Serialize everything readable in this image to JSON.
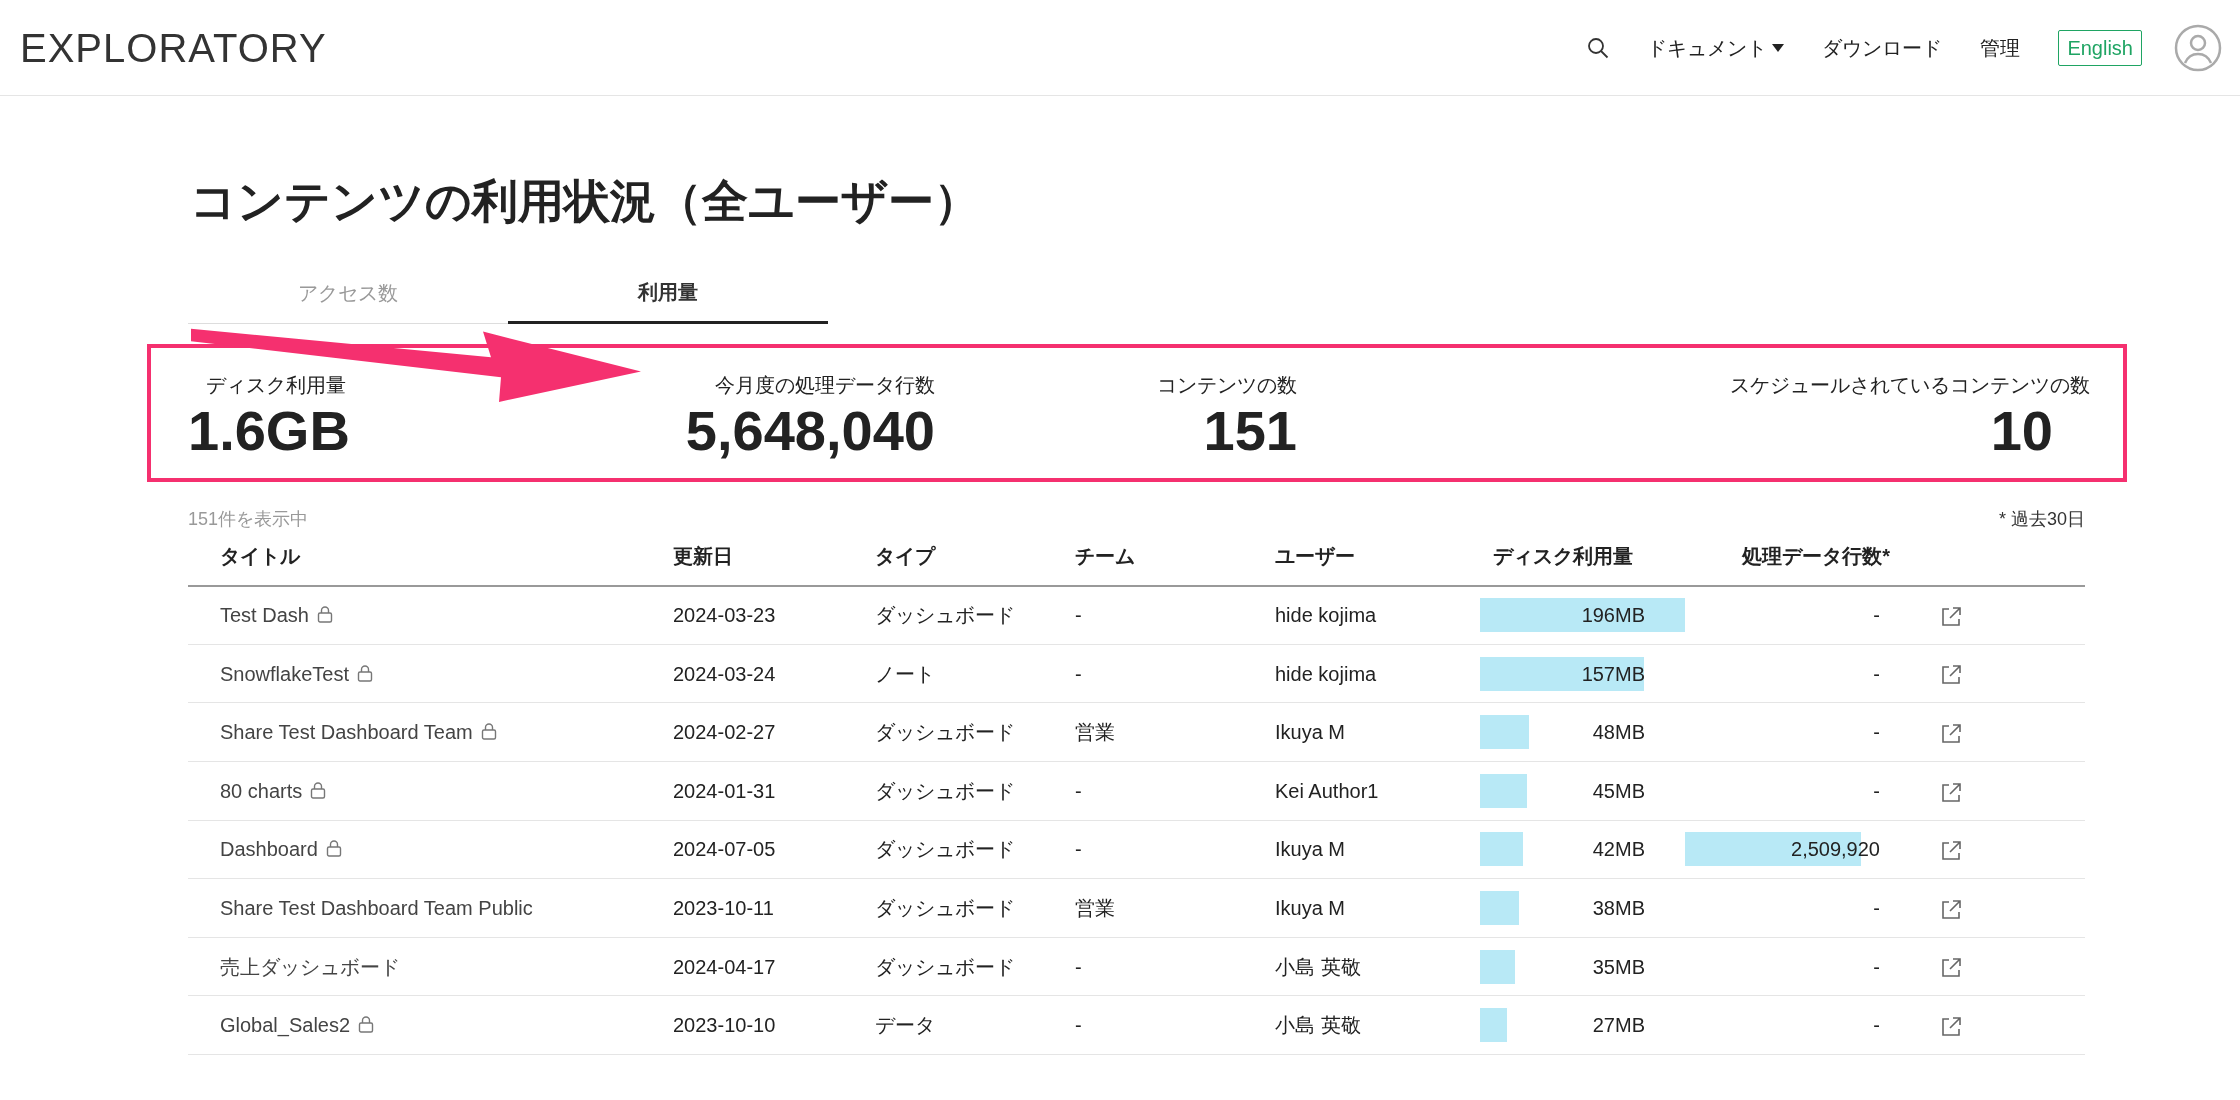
{
  "header": {
    "logo": "EXPLORATORY",
    "nav": [
      {
        "label": "ドキュメント",
        "dropdown": true
      },
      {
        "label": "ダウンロード",
        "dropdown": false
      },
      {
        "label": "管理",
        "dropdown": false
      }
    ],
    "language_button": "English"
  },
  "page_title": "コンテンツの利用状況（全ユーザー）",
  "annotation_arrow": true,
  "tabs": [
    {
      "label": "アクセス数",
      "selected": false
    },
    {
      "label": "利用量",
      "selected": true
    }
  ],
  "stats": {
    "highlighted": true,
    "items": [
      {
        "label": "ディスク利用量",
        "value": "1.6GB"
      },
      {
        "label": "今月度の処理データ行数",
        "value": "5,648,040"
      },
      {
        "label": "コンテンツの数",
        "value": "151"
      },
      {
        "label": "スケジュールされているコンテンツの数",
        "value": "10"
      }
    ]
  },
  "table": {
    "count_label": "151件を表示中",
    "note": "* 過去30日",
    "columns": [
      "タイトル",
      "更新日",
      "タイプ",
      "チーム",
      "ユーザー",
      "ディスク利用量",
      "処理データ行数*"
    ],
    "rows": [
      {
        "title": "Test Dash",
        "locked": true,
        "updated": "2024-03-23",
        "type": "ダッシュボード",
        "team": "-",
        "user": "hide kojima",
        "disk": "196MB",
        "disk_bar": {
          "level": 1.0
        },
        "rows": "-"
      },
      {
        "title": "SnowflakeTest",
        "locked": true,
        "updated": "2024-03-24",
        "type": "ノート",
        "team": "-",
        "user": "hide kojima",
        "disk": "157MB",
        "disk_bar": {
          "level": 0.8
        },
        "rows": "-"
      },
      {
        "title": "Share Test Dashboard Team",
        "locked": true,
        "updated": "2024-02-27",
        "type": "ダッシュボード",
        "team": "営業",
        "user": "Ikuya M",
        "disk": "48MB",
        "disk_bar": {
          "level": 0.24
        },
        "rows": "-"
      },
      {
        "title": "80 charts",
        "locked": true,
        "updated": "2024-01-31",
        "type": "ダッシュボード",
        "team": "-",
        "user": "Kei Author1",
        "disk": "45MB",
        "disk_bar": {
          "level": 0.23
        },
        "rows": "-"
      },
      {
        "title": "Dashboard",
        "locked": true,
        "updated": "2024-07-05",
        "type": "ダッシュボード",
        "team": "-",
        "user": "Ikuya M",
        "disk": "42MB",
        "disk_bar": {
          "level": 0.21
        },
        "rows": "2,509,920",
        "rows_bar": {
          "level": 0.86
        }
      },
      {
        "title": "Share Test Dashboard Team Public",
        "locked": false,
        "updated": "2023-10-11",
        "type": "ダッシュボード",
        "team": "営業",
        "user": "Ikuya M",
        "disk": "38MB",
        "disk_bar": {
          "level": 0.19
        },
        "rows": "-"
      },
      {
        "title": "売上ダッシュボード",
        "locked": false,
        "updated": "2024-04-17",
        "type": "ダッシュボード",
        "team": "-",
        "user": "小島 英敬",
        "disk": "35MB",
        "disk_bar": {
          "level": 0.17
        },
        "rows": "-"
      },
      {
        "title": "Global_Sales2",
        "locked": true,
        "updated": "2023-10-10",
        "type": "データ",
        "team": "-",
        "user": "小島 英敬",
        "disk": "27MB",
        "disk_bar": {
          "level": 0.13
        },
        "rows": "-"
      }
    ]
  }
}
